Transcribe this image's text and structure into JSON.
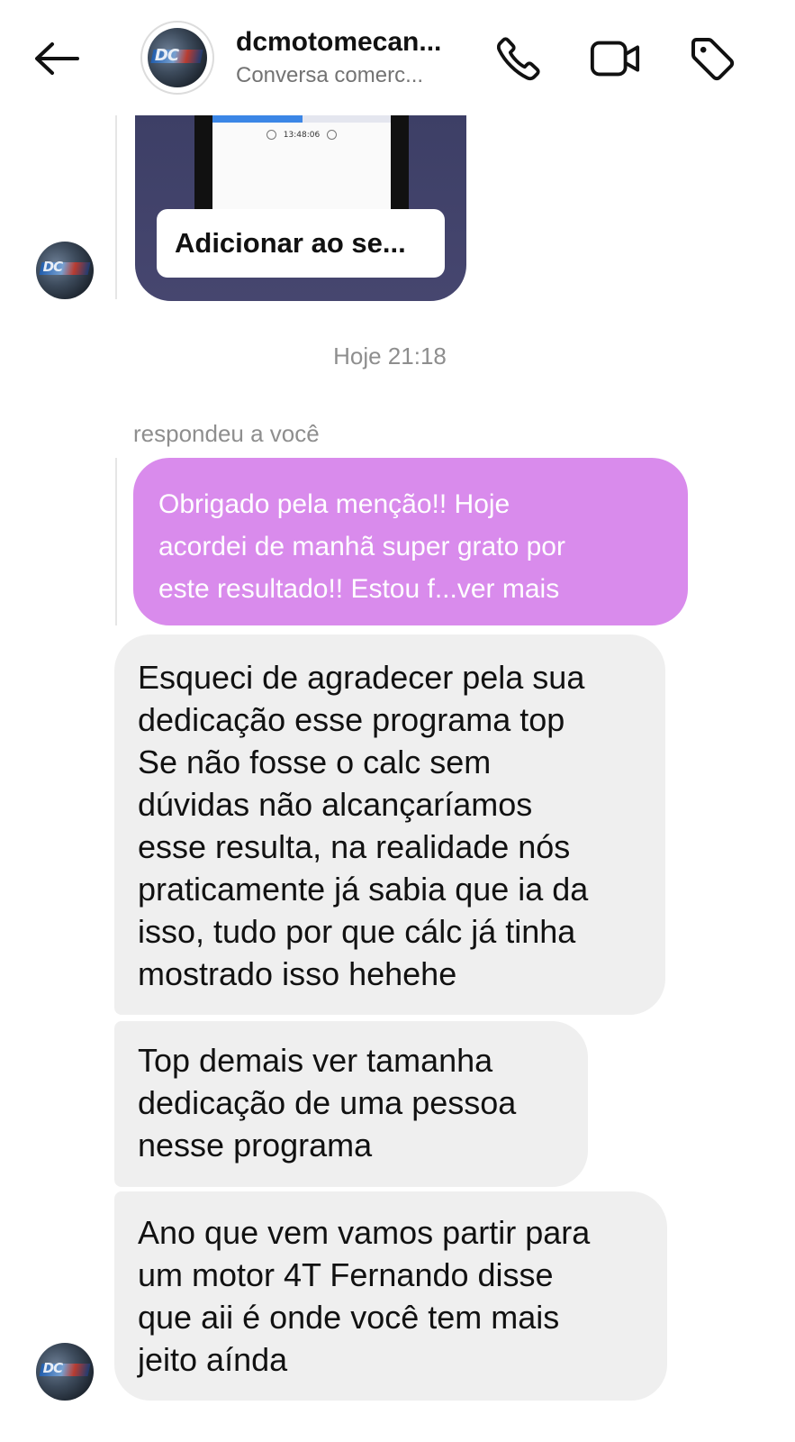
{
  "header": {
    "title": "dcmotomecan...",
    "subtitle": "Conversa comerc...",
    "icons": [
      "back-arrow-icon",
      "phone-icon",
      "video-camera-icon",
      "tag-icon"
    ]
  },
  "shared_post": {
    "phone_time": "13:48:06",
    "cta_label": "Adicionar ao se..."
  },
  "timestamp": "Hoje 21:18",
  "reply": {
    "label": "respondeu a você",
    "quoted_lines": [
      "Obrigado pela menção!! Hoje",
      "acordei de manhã super grato por",
      "este resultado!! Estou f...ver mais"
    ]
  },
  "messages": [
    {
      "lines": [
        "Esqueci de agradecer pela sua",
        "dedicação esse programa top",
        "Se não fosse o calc sem",
        "dúvidas não alcançaríamos",
        "esse resulta, na realidade nós",
        "praticamente já sabia que ia da",
        "isso, tudo por que cálc já tinha",
        "mostrado isso hehehe"
      ]
    },
    {
      "lines": [
        "Top demais ver tamanha",
        "dedicação de uma pessoa",
        "nesse programa"
      ]
    },
    {
      "lines": [
        "Ano que vem vamos partir para",
        "um motor 4T Fernando disse",
        "que aii é onde você tem mais",
        "jeito aínda"
      ]
    }
  ],
  "colors": {
    "reply_bubble": "#d98bec",
    "incoming_bubble": "#efefef",
    "secondary_text": "#8e8e8e"
  }
}
